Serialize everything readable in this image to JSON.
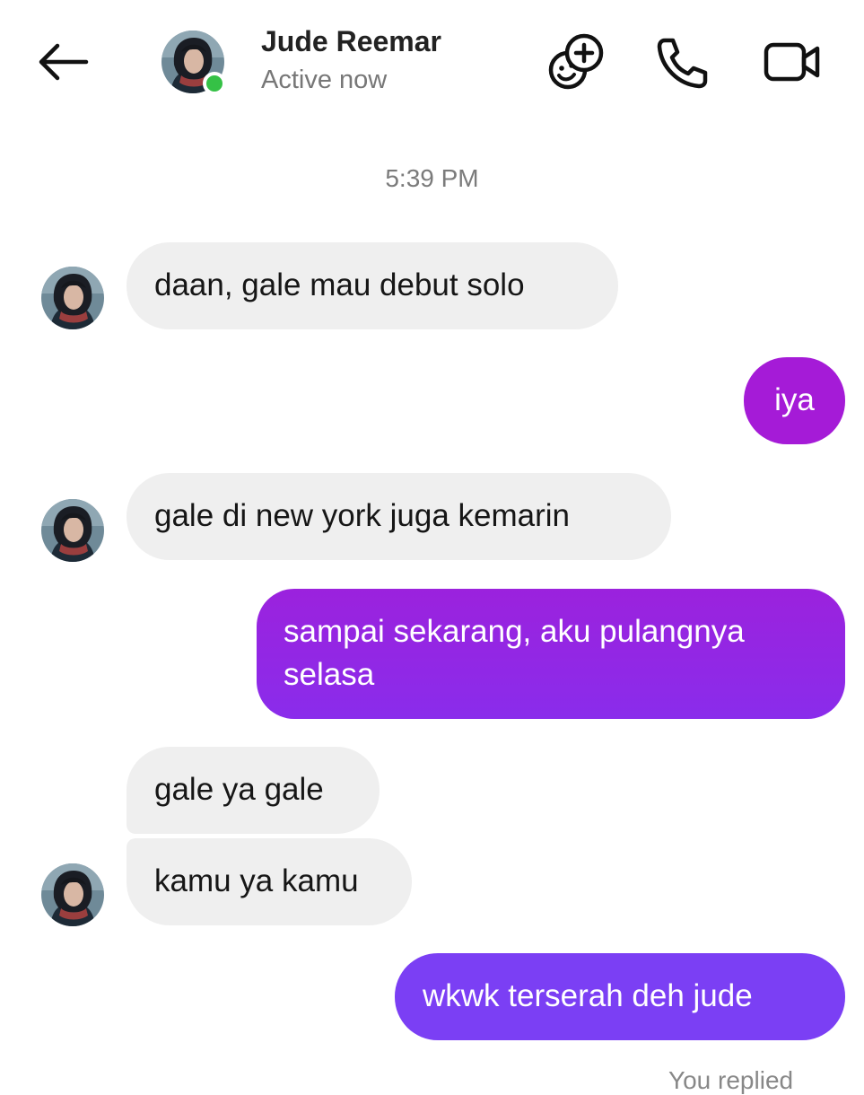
{
  "header": {
    "contact_name": "Jude Reemar",
    "status": "Active now",
    "online_color": "#35c146",
    "icons": [
      "back-arrow-icon",
      "effects-plus-icon",
      "phone-icon",
      "video-camera-icon"
    ]
  },
  "conversation": {
    "timestamp": "5:39 PM",
    "messages": [
      {
        "from": "them",
        "text": "daan, gale mau debut solo"
      },
      {
        "from": "me",
        "text": "iya"
      },
      {
        "from": "them",
        "text": "gale di new york juga kemarin"
      },
      {
        "from": "me",
        "lines": [
          "sampai sekarang, aku pulangnya",
          "selasa"
        ]
      },
      {
        "from": "them",
        "text": "gale ya gale"
      },
      {
        "from": "them",
        "text": "kamu ya kamu"
      },
      {
        "from": "me",
        "text": "wkwk terserah deh jude"
      }
    ],
    "seen_label": "You replied"
  },
  "colors": {
    "incoming_bubble": "#efefef",
    "outgoing_top": "#a31fd8",
    "outgoing_bottom": "#7a3ff5"
  }
}
